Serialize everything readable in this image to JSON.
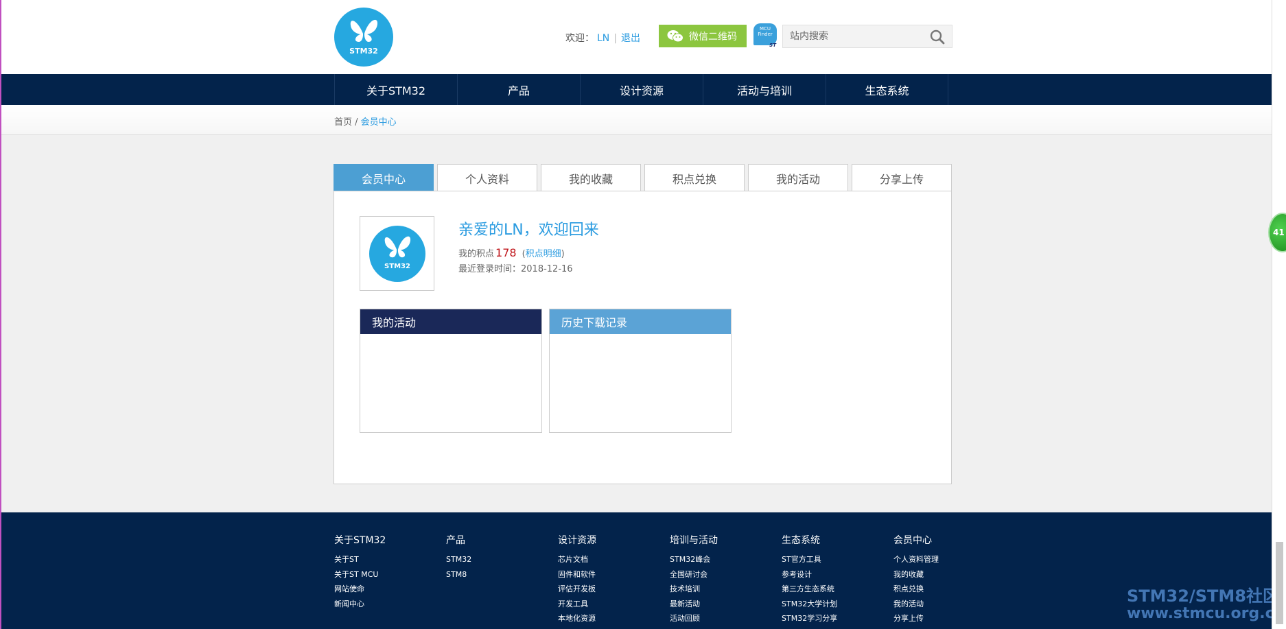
{
  "header": {
    "logo_text": "STM32",
    "welcome_label": "欢迎：",
    "username": "LN",
    "separator": "|",
    "logout": "退出",
    "wechat_button": "微信二维码",
    "mcu_finder": "MCU Finder",
    "mcu_finder_brand": "ST",
    "search_placeholder": "站内搜索"
  },
  "nav": {
    "items": [
      "关于STM32",
      "产品",
      "设计资源",
      "活动与培训",
      "生态系统"
    ]
  },
  "breadcrumb": {
    "home": "首页",
    "sep": " / ",
    "current": "会员中心"
  },
  "tabs": [
    "会员中心",
    "个人资料",
    "我的收藏",
    "积点兑换",
    "我的活动",
    "分享上传"
  ],
  "profile": {
    "avatar_text": "STM32",
    "greeting": "亲爱的LN，欢迎回来",
    "points_label": "我的积点",
    "points_value": "178",
    "points_detail_open": "(",
    "points_detail": "积点明细",
    "points_detail_close": ")",
    "last_login_label": "最近登录时间：",
    "last_login_value": "2018-12-16"
  },
  "boxes": {
    "activities": "我的活动",
    "downloads": "历史下载记录"
  },
  "footer": {
    "columns": [
      {
        "title": "关于STM32",
        "links": [
          "关于ST",
          "关于ST MCU",
          "网站使命",
          "新闻中心"
        ]
      },
      {
        "title": "产品",
        "links": [
          "STM32",
          "STM8"
        ]
      },
      {
        "title": "设计资源",
        "links": [
          "芯片文档",
          "固件和软件",
          "评估开发板",
          "开发工具",
          "本地化资源"
        ]
      },
      {
        "title": "培训与活动",
        "links": [
          "STM32峰会",
          "全国研讨会",
          "技术培训",
          "最新活动",
          "活动回顾"
        ]
      },
      {
        "title": "生态系统",
        "links": [
          "ST官方工具",
          "参考设计",
          "第三方生态系统",
          "STM32大学计划",
          "STM32学习分享"
        ]
      },
      {
        "title": "会员中心",
        "links": [
          "个人资料管理",
          "我的收藏",
          "积点兑换",
          "我的活动",
          "分享上传"
        ]
      }
    ]
  },
  "watermark": {
    "line1": "STM32/STM8社区",
    "line2": "www.stmcu.org.c"
  },
  "float_ball": "41",
  "colors": {
    "nav_bg": "#03234b",
    "accent": "#2a9be0",
    "tab_active": "#4c9fd3",
    "wechat": "#8cc63f",
    "points": "#c0161b"
  }
}
